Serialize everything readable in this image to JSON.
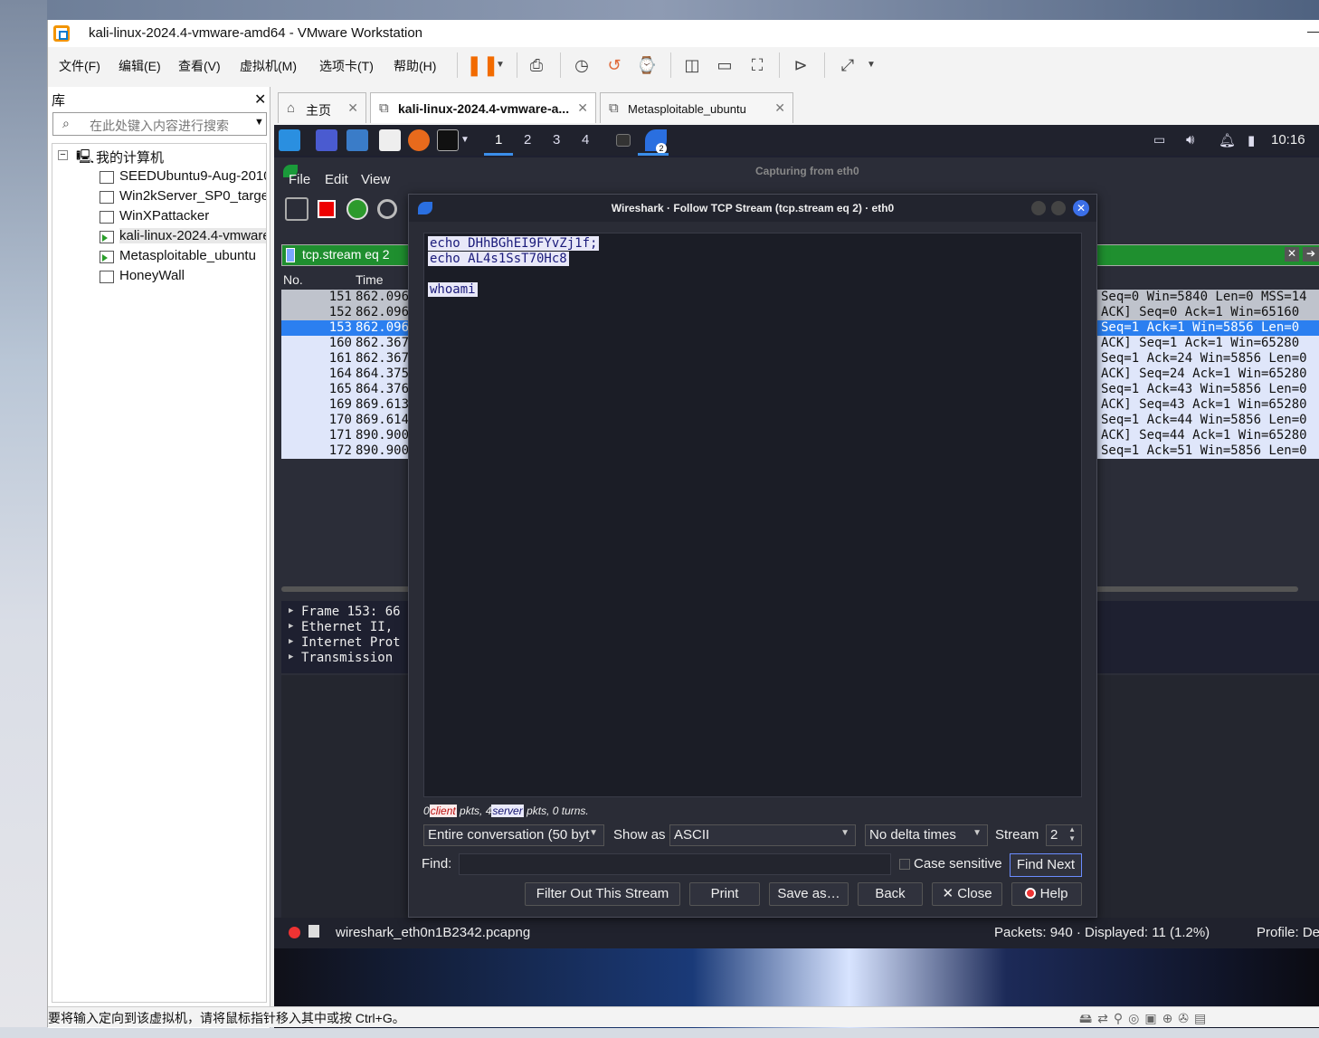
{
  "window": {
    "title": "kali-linux-2024.4-vmware-amd64 - VMware Workstation"
  },
  "menu": [
    "文件(F)",
    "编辑(E)",
    "查看(V)",
    "虚拟机(M)",
    "选项卡(T)",
    "帮助(H)"
  ],
  "library": {
    "title": "库",
    "search_placeholder": "在此处键入内容进行搜索",
    "root": "我的计算机",
    "vms": [
      "SEEDUbuntu9-Aug-2010",
      "Win2kServer_SP0_target",
      "WinXPattacker",
      "kali-linux-2024.4-vmware",
      "Metasploitable_ubuntu",
      "HoneyWall"
    ]
  },
  "tabs": [
    {
      "label": "主页"
    },
    {
      "label": "kali-linux-2024.4-vmware-a..."
    },
    {
      "label": "Metasploitable_ubuntu"
    }
  ],
  "kali_panel": {
    "workspaces": [
      "1",
      "2",
      "3",
      "4"
    ],
    "badge": "2",
    "clock": "10:16"
  },
  "wireshark": {
    "capturing": "Capturing from eth0",
    "menu": [
      "File",
      "Edit",
      "View"
    ],
    "filter": "tcp.stream eq 2",
    "columns": {
      "no": "No.",
      "time": "Time"
    },
    "packets": [
      {
        "no": "151",
        "time": "862.096",
        "info": "Seq=0 Win=5840 Len=0 MSS=14"
      },
      {
        "no": "152",
        "time": "862.096",
        "info": "ACK] Seq=0 Ack=1 Win=65160"
      },
      {
        "no": "153",
        "time": "862.096",
        "info": "Seq=1 Ack=1 Win=5856 Len=0"
      },
      {
        "no": "160",
        "time": "862.367",
        "info": "ACK] Seq=1 Ack=1 Win=65280"
      },
      {
        "no": "161",
        "time": "862.367",
        "info": "Seq=1 Ack=24 Win=5856 Len=0"
      },
      {
        "no": "164",
        "time": "864.375",
        "info": "ACK] Seq=24 Ack=1 Win=65280"
      },
      {
        "no": "165",
        "time": "864.376",
        "info": "Seq=1 Ack=43 Win=5856 Len=0"
      },
      {
        "no": "169",
        "time": "869.613",
        "info": "ACK] Seq=43 Ack=1 Win=65280"
      },
      {
        "no": "170",
        "time": "869.614",
        "info": "Seq=1 Ack=44 Win=5856 Len=0"
      },
      {
        "no": "171",
        "time": "890.900",
        "info": "ACK] Seq=44 Ack=1 Win=65280"
      },
      {
        "no": "172",
        "time": "890.900",
        "info": "Seq=1 Ack=51 Win=5856 Len=0"
      }
    ],
    "details": [
      "Frame 153: 66",
      "Ethernet II,",
      "Internet Prot",
      "Transmission"
    ],
    "status_file": "wireshark_eth0n1B2342.pcapng",
    "status_packets": "Packets: 940 · Displayed: 11 (1.2%)",
    "profile": "Profile: De"
  },
  "dialog": {
    "title": "Wireshark · Follow TCP Stream (tcp.stream eq 2) · eth0",
    "lines": [
      "echo DHhBGhEI9FYvZj1f;",
      "echo AL4s1SsT70Hc8",
      "",
      "whoami"
    ],
    "stats": {
      "client_count": "0",
      "client": "client",
      "client_suffix": " pkts, 4",
      "server": "server",
      "server_suffix": " pkts, 0 turns."
    },
    "conversation": "Entire conversation (50 byt",
    "show_as_label": "Show as",
    "show_as": "ASCII",
    "delta": "No delta times",
    "stream_label": "Stream",
    "stream": "2",
    "find_label": "Find:",
    "case_sensitive": "Case sensitive",
    "find_next": "Find Next",
    "buttons": {
      "filter_out": "Filter Out This Stream",
      "print": "Print",
      "save_as": "Save as…",
      "back": "Back",
      "close": "Close",
      "help": "Help"
    }
  },
  "status_bar": "要将输入定向到该虚拟机，请将鼠标指针移入其中或按 Ctrl+G。"
}
